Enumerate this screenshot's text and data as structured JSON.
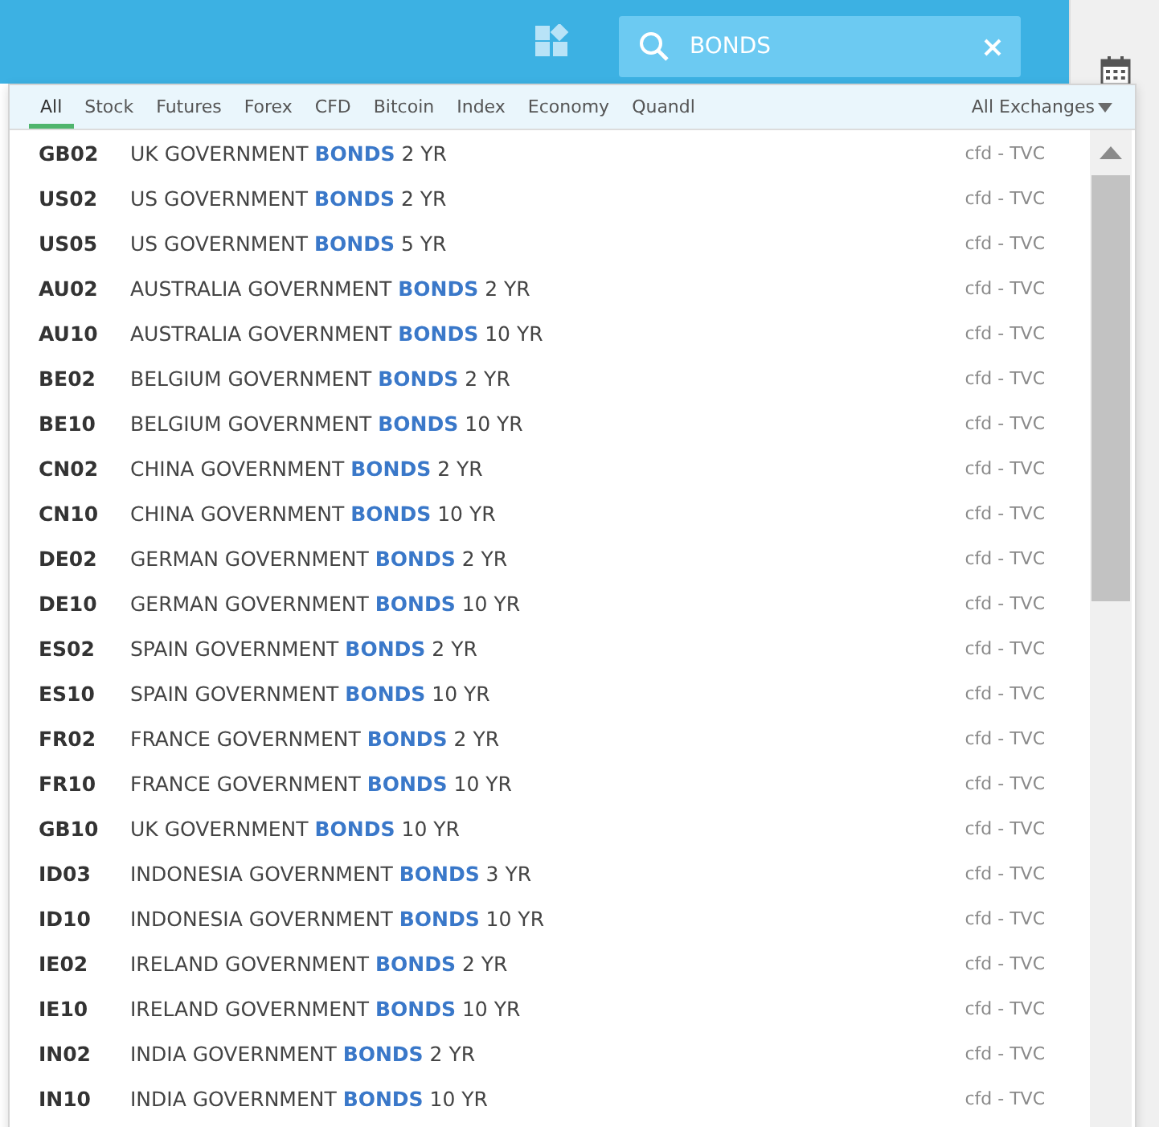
{
  "search": {
    "value": "BONDS"
  },
  "tabs": [
    {
      "label": "All",
      "selected": true
    },
    {
      "label": "Stock",
      "selected": false
    },
    {
      "label": "Futures",
      "selected": false
    },
    {
      "label": "Forex",
      "selected": false
    },
    {
      "label": "CFD",
      "selected": false
    },
    {
      "label": "Bitcoin",
      "selected": false
    },
    {
      "label": "Index",
      "selected": false
    },
    {
      "label": "Economy",
      "selected": false
    },
    {
      "label": "Quandl",
      "selected": false
    }
  ],
  "exchange_filter": "All Exchanges",
  "results": [
    {
      "symbol": "GB02",
      "before": "UK GOVERNMENT ",
      "match": "BONDS",
      "after": " 2 YR",
      "source": "cfd - TVC"
    },
    {
      "symbol": "US02",
      "before": "US GOVERNMENT ",
      "match": "BONDS",
      "after": " 2 YR",
      "source": "cfd - TVC"
    },
    {
      "symbol": "US05",
      "before": "US GOVERNMENT ",
      "match": "BONDS",
      "after": " 5 YR",
      "source": "cfd - TVC"
    },
    {
      "symbol": "AU02",
      "before": "AUSTRALIA GOVERNMENT ",
      "match": "BONDS",
      "after": " 2 YR",
      "source": "cfd - TVC"
    },
    {
      "symbol": "AU10",
      "before": "AUSTRALIA GOVERNMENT ",
      "match": "BONDS",
      "after": " 10 YR",
      "source": "cfd - TVC"
    },
    {
      "symbol": "BE02",
      "before": "BELGIUM GOVERNMENT ",
      "match": "BONDS",
      "after": " 2 YR",
      "source": "cfd - TVC"
    },
    {
      "symbol": "BE10",
      "before": "BELGIUM GOVERNMENT ",
      "match": "BONDS",
      "after": " 10 YR",
      "source": "cfd - TVC"
    },
    {
      "symbol": "CN02",
      "before": "CHINA GOVERNMENT ",
      "match": "BONDS",
      "after": " 2 YR",
      "source": "cfd - TVC"
    },
    {
      "symbol": "CN10",
      "before": "CHINA GOVERNMENT ",
      "match": "BONDS",
      "after": " 10 YR",
      "source": "cfd - TVC"
    },
    {
      "symbol": "DE02",
      "before": "GERMAN GOVERNMENT ",
      "match": "BONDS",
      "after": " 2 YR",
      "source": "cfd - TVC"
    },
    {
      "symbol": "DE10",
      "before": "GERMAN GOVERNMENT ",
      "match": "BONDS",
      "after": " 10 YR",
      "source": "cfd - TVC"
    },
    {
      "symbol": "ES02",
      "before": "SPAIN GOVERNMENT ",
      "match": "BONDS",
      "after": " 2 YR",
      "source": "cfd - TVC"
    },
    {
      "symbol": "ES10",
      "before": "SPAIN GOVERNMENT ",
      "match": "BONDS",
      "after": " 10 YR",
      "source": "cfd - TVC"
    },
    {
      "symbol": "FR02",
      "before": "FRANCE GOVERNMENT ",
      "match": "BONDS",
      "after": " 2 YR",
      "source": "cfd - TVC"
    },
    {
      "symbol": "FR10",
      "before": "FRANCE GOVERNMENT ",
      "match": "BONDS",
      "after": " 10 YR",
      "source": "cfd - TVC"
    },
    {
      "symbol": "GB10",
      "before": "UK GOVERNMENT ",
      "match": "BONDS",
      "after": " 10 YR",
      "source": "cfd - TVC"
    },
    {
      "symbol": "ID03",
      "before": "INDONESIA GOVERNMENT ",
      "match": "BONDS",
      "after": " 3 YR",
      "source": "cfd - TVC"
    },
    {
      "symbol": "ID10",
      "before": "INDONESIA GOVERNMENT ",
      "match": "BONDS",
      "after": " 10 YR",
      "source": "cfd - TVC"
    },
    {
      "symbol": "IE02",
      "before": "IRELAND GOVERNMENT ",
      "match": "BONDS",
      "after": " 2 YR",
      "source": "cfd - TVC"
    },
    {
      "symbol": "IE10",
      "before": "IRELAND GOVERNMENT ",
      "match": "BONDS",
      "after": " 10 YR",
      "source": "cfd - TVC"
    },
    {
      "symbol": "IN02",
      "before": "INDIA GOVERNMENT ",
      "match": "BONDS",
      "after": " 2 YR",
      "source": "cfd - TVC"
    },
    {
      "symbol": "IN10",
      "before": "INDIA GOVERNMENT ",
      "match": "BONDS",
      "after": " 10 YR",
      "source": "cfd - TVC"
    }
  ]
}
